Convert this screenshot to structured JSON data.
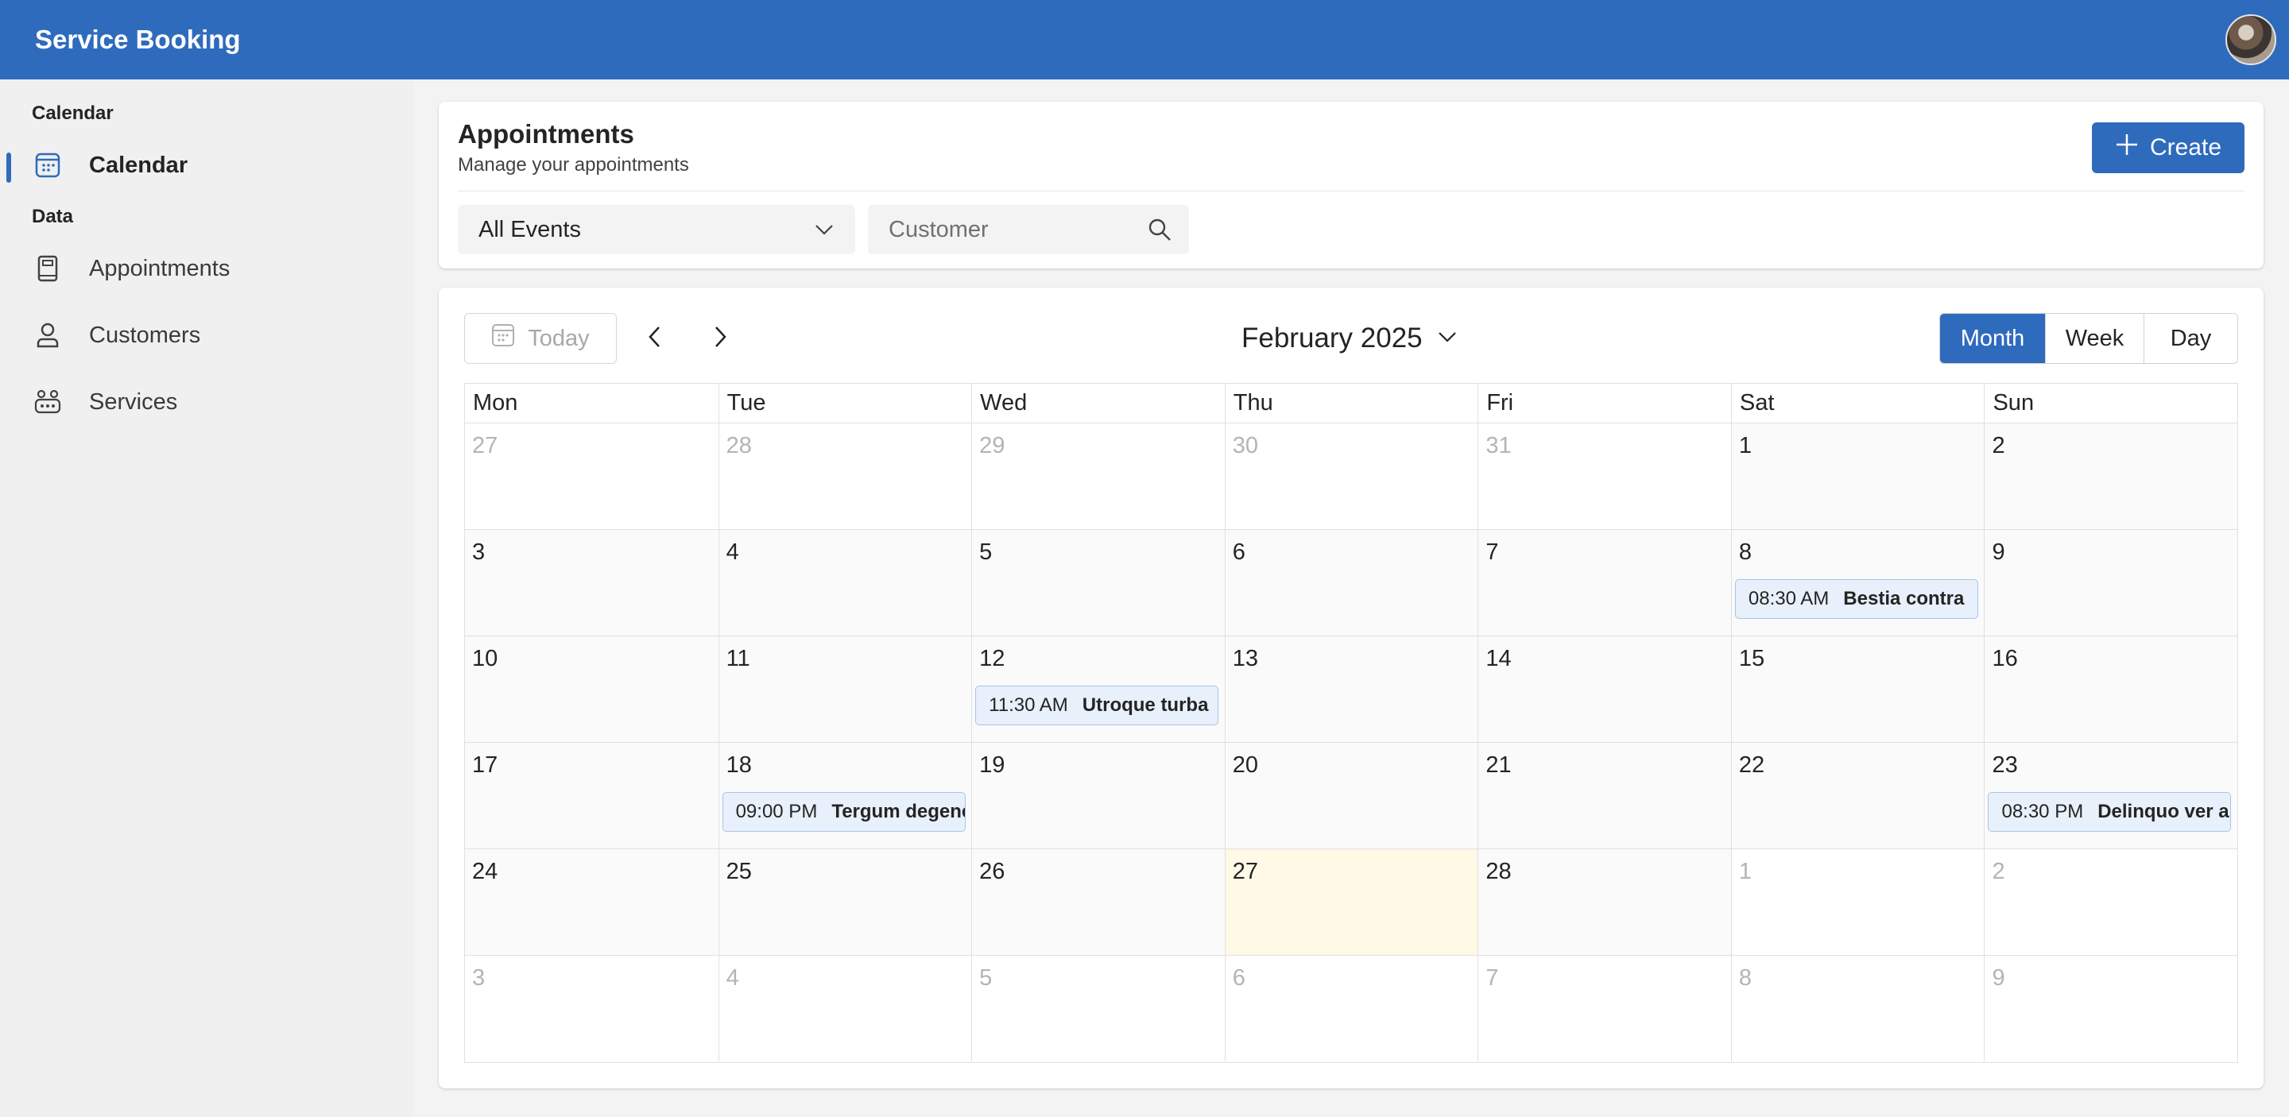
{
  "app": {
    "title": "Service Booking"
  },
  "sidebar": {
    "sections": [
      {
        "label": "Calendar",
        "items": [
          {
            "label": "Calendar",
            "icon": "calendar-icon",
            "active": true
          }
        ]
      },
      {
        "label": "Data",
        "items": [
          {
            "label": "Appointments",
            "icon": "notebook-icon",
            "active": false
          },
          {
            "label": "Customers",
            "icon": "person-icon",
            "active": false
          },
          {
            "label": "Services",
            "icon": "people-team-icon",
            "active": false
          }
        ]
      }
    ]
  },
  "header": {
    "title": "Appointments",
    "subtitle": "Manage your appointments",
    "create_label": "Create",
    "event_filter": "All Events",
    "customer_placeholder": "Customer"
  },
  "calendar": {
    "today_label": "Today",
    "month_label": "February 2025",
    "views": [
      "Month",
      "Week",
      "Day"
    ],
    "active_view": "Month",
    "weekdays": [
      "Mon",
      "Tue",
      "Wed",
      "Thu",
      "Fri",
      "Sat",
      "Sun"
    ],
    "weeks": [
      [
        {
          "d": "27",
          "o": true
        },
        {
          "d": "28",
          "o": true
        },
        {
          "d": "29",
          "o": true
        },
        {
          "d": "30",
          "o": true
        },
        {
          "d": "31",
          "o": true
        },
        {
          "d": "1"
        },
        {
          "d": "2"
        }
      ],
      [
        {
          "d": "3"
        },
        {
          "d": "4"
        },
        {
          "d": "5"
        },
        {
          "d": "6"
        },
        {
          "d": "7"
        },
        {
          "d": "8",
          "event": {
            "time": "08:30 AM",
            "title": "Bestia contra"
          }
        },
        {
          "d": "9"
        }
      ],
      [
        {
          "d": "10"
        },
        {
          "d": "11"
        },
        {
          "d": "12",
          "event": {
            "time": "11:30 AM",
            "title": "Utroque turba"
          }
        },
        {
          "d": "13"
        },
        {
          "d": "14"
        },
        {
          "d": "15"
        },
        {
          "d": "16"
        }
      ],
      [
        {
          "d": "17"
        },
        {
          "d": "18",
          "event": {
            "time": "09:00 PM",
            "title": "Tergum degener"
          }
        },
        {
          "d": "19"
        },
        {
          "d": "20"
        },
        {
          "d": "21"
        },
        {
          "d": "22"
        },
        {
          "d": "23",
          "event": {
            "time": "08:30 PM",
            "title": "Delinquo ver a"
          }
        }
      ],
      [
        {
          "d": "24"
        },
        {
          "d": "25"
        },
        {
          "d": "26"
        },
        {
          "d": "27",
          "today": true
        },
        {
          "d": "28"
        },
        {
          "d": "1",
          "o": true
        },
        {
          "d": "2",
          "o": true
        }
      ],
      [
        {
          "d": "3",
          "o": true
        },
        {
          "d": "4",
          "o": true
        },
        {
          "d": "5",
          "o": true
        },
        {
          "d": "6",
          "o": true
        },
        {
          "d": "7",
          "o": true
        },
        {
          "d": "8",
          "o": true
        },
        {
          "d": "9",
          "o": true
        }
      ]
    ]
  },
  "colors": {
    "brand": "#2f6bbd",
    "today_bg": "#fff9e6",
    "event_bg": "#e8f0fb"
  }
}
